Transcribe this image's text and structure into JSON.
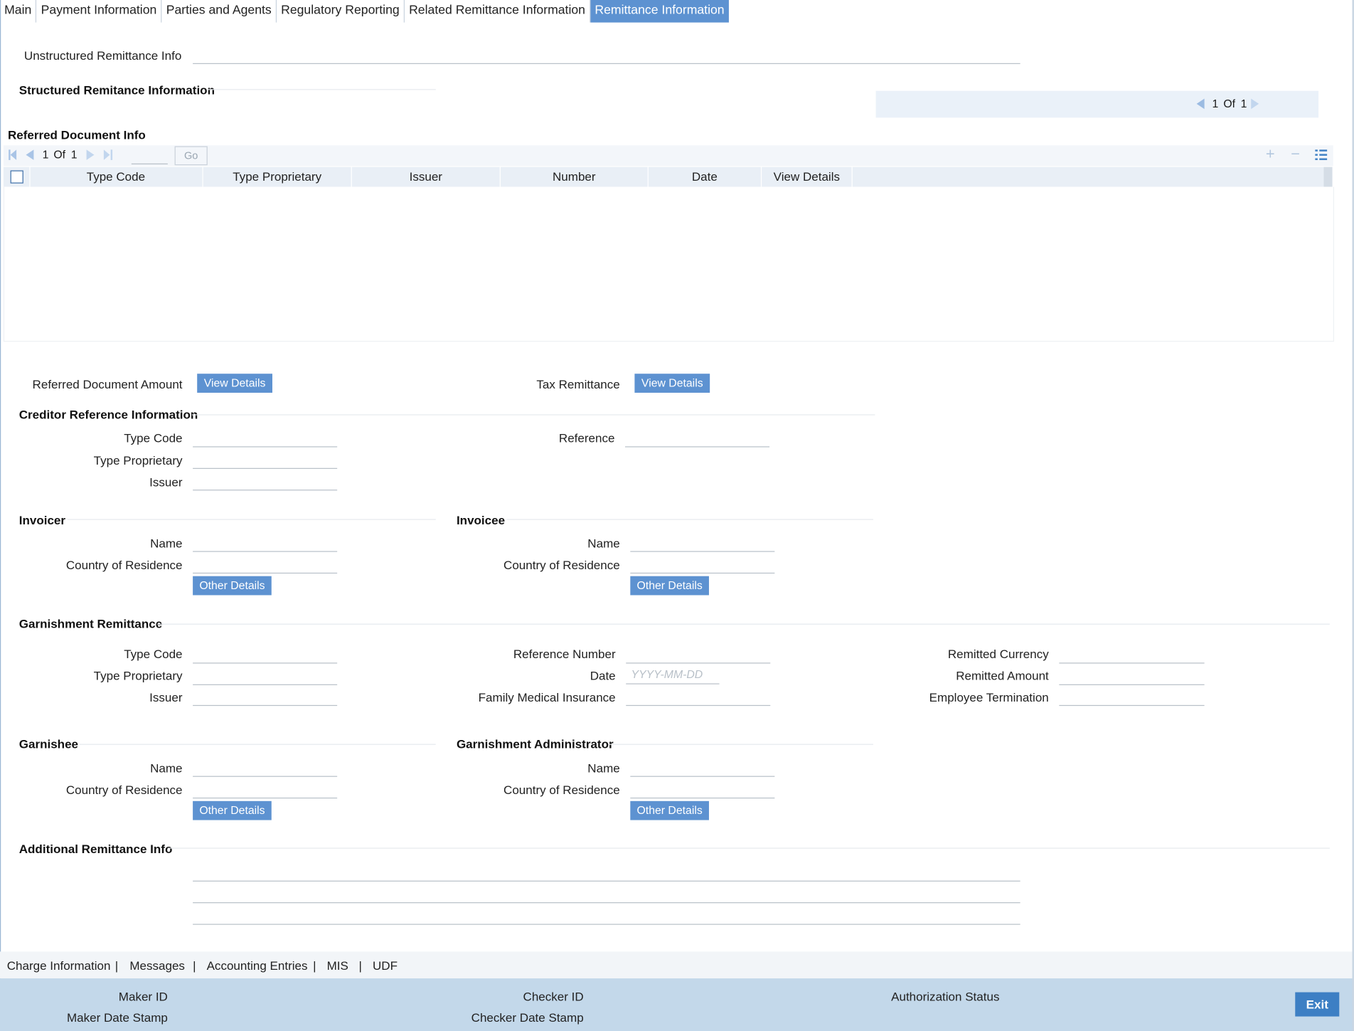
{
  "tabs": [
    "Main",
    "Payment Information",
    "Parties and Agents",
    "Regulatory Reporting",
    "Related Remittance Information",
    "Remittance Information"
  ],
  "unstructured_label": "Unstructured Remittance Info",
  "structured_title": "Structured Remitance Information",
  "structured_pager": {
    "current": "1",
    "of": "Of",
    "total": "1"
  },
  "referred_doc": {
    "title": "Referred Document Info",
    "pager": {
      "current": "1",
      "of": "Of",
      "total": "1",
      "go": "Go"
    },
    "columns": [
      "Type Code",
      "Type Proprietary",
      "Issuer",
      "Number",
      "Date",
      "View Details"
    ]
  },
  "referred_amount_label": "Referred Document Amount",
  "tax_remittance_label": "Tax Remittance",
  "view_details": "View Details",
  "creditor": {
    "title": "Creditor Reference Information",
    "type_code": "Type Code",
    "type_proprietary": "Type Proprietary",
    "issuer": "Issuer",
    "reference": "Reference"
  },
  "invoicer": {
    "title": "Invoicer",
    "name": "Name",
    "country": "Country of Residence",
    "other": "Other Details"
  },
  "invoicee": {
    "title": "Invoicee",
    "name": "Name",
    "country": "Country of Residence",
    "other": "Other Details"
  },
  "garnishment": {
    "title": "Garnishment Remittance",
    "type_code": "Type Code",
    "type_proprietary": "Type Proprietary",
    "issuer": "Issuer",
    "reference_number": "Reference Number",
    "date": "Date",
    "date_placeholder": "YYYY-MM-DD",
    "family_medical": "Family Medical Insurance",
    "remitted_currency": "Remitted Currency",
    "remitted_amount": "Remitted Amount",
    "employee_termination": "Employee Termination"
  },
  "garnishee": {
    "title": "Garnishee",
    "name": "Name",
    "country": "Country of Residence",
    "other": "Other Details"
  },
  "garnishment_admin": {
    "title": "Garnishment Administrator",
    "name": "Name",
    "country": "Country of Residence",
    "other": "Other Details"
  },
  "additional_title": "Additional Remittance Info",
  "footer_links": [
    "Charge Information",
    "|",
    "Messages",
    "|",
    "Accounting Entries",
    "|",
    "MIS",
    "|",
    "UDF"
  ],
  "status": {
    "maker_id": "Maker ID",
    "maker_date": "Maker Date Stamp",
    "checker_id": "Checker ID",
    "checker_date": "Checker Date Stamp",
    "auth_status": "Authorization Status",
    "exit": "Exit"
  },
  "colors": {
    "accent": "#5d92d1",
    "status_bar": "#c3d8ea",
    "exit": "#3d7fc4"
  }
}
